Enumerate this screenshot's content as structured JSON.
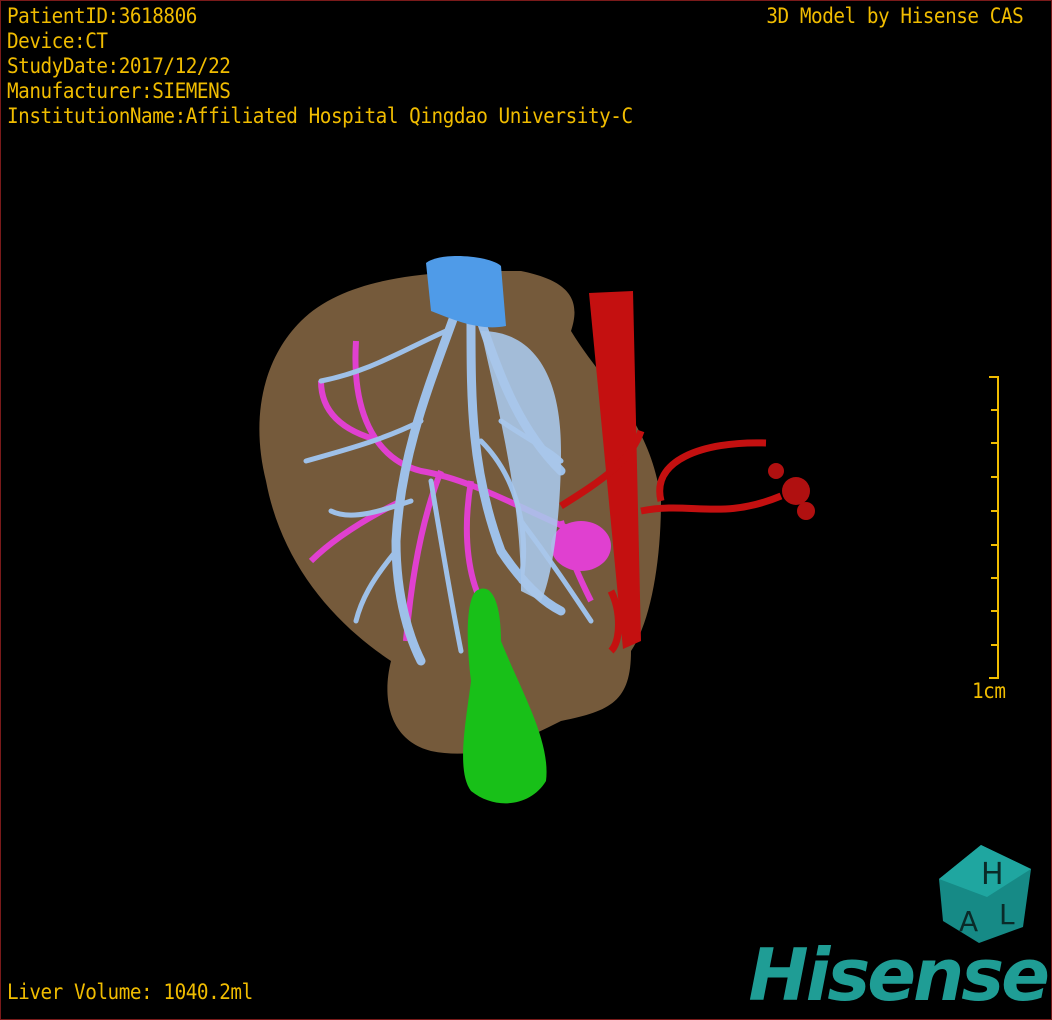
{
  "overlay": {
    "patient_id": "PatientID:3618806",
    "device": "Device:CT",
    "study_date": "StudyDate:2017/12/22",
    "manufacturer": "Manufacturer:SIEMENS",
    "institution": "InstitutionName:Affiliated Hospital Qingdao University-C",
    "credit": "3D Model by Hisense CAS",
    "liver_volume": "Liver Volume: 1040.2ml",
    "scale_label": "1cm"
  },
  "logo": {
    "text": "Hisense",
    "cube_letters": [
      "H",
      "A",
      "L"
    ],
    "color": "#1f9d95"
  },
  "colors": {
    "text": "#f0bc00",
    "liver": "#8a6a45",
    "hepatic_vein": "#9ec0e8",
    "portal_vein": "#e040d0",
    "artery": "#c41010",
    "gallbladder": "#18c018",
    "ivc": "#4f9be8"
  }
}
